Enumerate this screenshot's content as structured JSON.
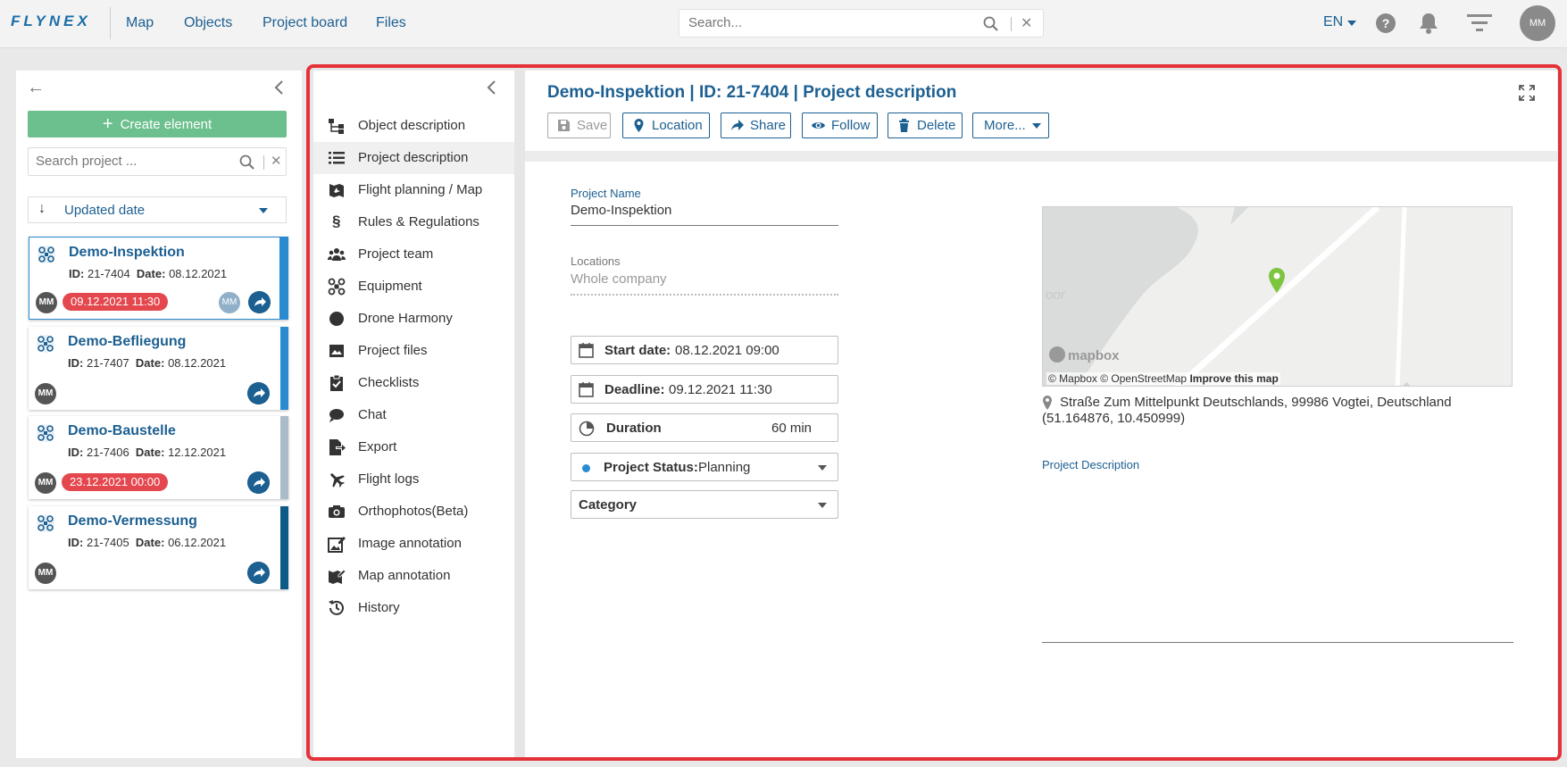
{
  "topbar": {
    "logo": "FLYNEX",
    "nav": [
      "Map",
      "Objects",
      "Project board",
      "Files"
    ],
    "search_placeholder": "Search...",
    "language": "EN",
    "help": "?",
    "avatar": "MM"
  },
  "left": {
    "create_label": "Create element",
    "search_placeholder": "Search project ...",
    "sort_label": "Updated date",
    "cards": [
      {
        "title": "Demo-Inspektion",
        "id_label": "ID:",
        "id": "21-7404",
        "date_label": "Date:",
        "date": "08.12.2021",
        "avatar": "MM",
        "badge": "09.12.2021 11:30",
        "avatar2": "MM",
        "strip_color": "#2a8bd1"
      },
      {
        "title": "Demo-Befliegung",
        "id_label": "ID:",
        "id": "21-7407",
        "date_label": "Date:",
        "date": "08.12.2021",
        "avatar": "MM",
        "badge": "",
        "strip_color": "#2a8bd1"
      },
      {
        "title": "Demo-Baustelle",
        "id_label": "ID:",
        "id": "21-7406",
        "date_label": "Date:",
        "date": "12.12.2021",
        "avatar": "MM",
        "badge": "23.12.2021 00:00",
        "strip_color": "#a9bcc8"
      },
      {
        "title": "Demo-Vermessung",
        "id_label": "ID:",
        "id": "21-7405",
        "date_label": "Date:",
        "date": "06.12.2021",
        "avatar": "MM",
        "badge": "",
        "strip_color": "#0e5a87"
      }
    ]
  },
  "innernav": {
    "items": [
      {
        "label": "Object description",
        "icon": "hierarchy-icon"
      },
      {
        "label": "Project description",
        "icon": "list-icon"
      },
      {
        "label": "Flight planning / Map",
        "icon": "flight-map-icon"
      },
      {
        "label": "Rules & Regulations",
        "icon": "section-icon"
      },
      {
        "label": "Project team",
        "icon": "team-icon"
      },
      {
        "label": "Equipment",
        "icon": "drone-icon"
      },
      {
        "label": "Drone Harmony",
        "icon": "circle-icon"
      },
      {
        "label": "Project files",
        "icon": "image-file-icon"
      },
      {
        "label": "Checklists",
        "icon": "clipboard-check-icon"
      },
      {
        "label": "Chat",
        "icon": "chat-icon"
      },
      {
        "label": "Export",
        "icon": "export-icon"
      },
      {
        "label": "Flight logs",
        "icon": "plane-icon"
      },
      {
        "label": "Orthophotos(Beta)",
        "icon": "camera-icon"
      },
      {
        "label": "Image annotation",
        "icon": "image-annotation-icon"
      },
      {
        "label": "Map annotation",
        "icon": "map-annotation-icon"
      },
      {
        "label": "History",
        "icon": "history-icon"
      }
    ],
    "active_index": 1
  },
  "content": {
    "title": "Demo-Inspektion | ID: 21-7404 | Project description",
    "toolbar": {
      "save": "Save",
      "location": "Location",
      "share": "Share",
      "follow": "Follow",
      "delete": "Delete",
      "more": "More..."
    },
    "project_name_label": "Project Name",
    "project_name": "Demo-Inspektion",
    "locations_label": "Locations",
    "locations_value": "Whole company",
    "start_date_label": "Start date:",
    "start_date": "08.12.2021 09:00",
    "deadline_label": "Deadline:",
    "deadline": "09.12.2021 11:30",
    "duration_label": "Duration",
    "duration": "60 min",
    "status_label": "Project Status:",
    "status": "Planning",
    "status_color": "#2a8bd1",
    "category_label": "Category",
    "map": {
      "attribution_1": "© Mapbox",
      "attribution_2": "© OpenStreetMap",
      "improve": "Improve this map",
      "logo": "mapbox",
      "place_fragment": "oor",
      "pin_color": "#7dc43f"
    },
    "address": "Straße Zum Mittelpunkt Deutschlands, 99986 Vogtei, Deutschland",
    "coords": "(51.164876, 10.450999)",
    "project_description_label": "Project Description"
  },
  "colors": {
    "primary": "#1c5f91",
    "create_green": "#6cc08d",
    "frame_red": "#e53238",
    "badge_red": "#e4474d"
  }
}
